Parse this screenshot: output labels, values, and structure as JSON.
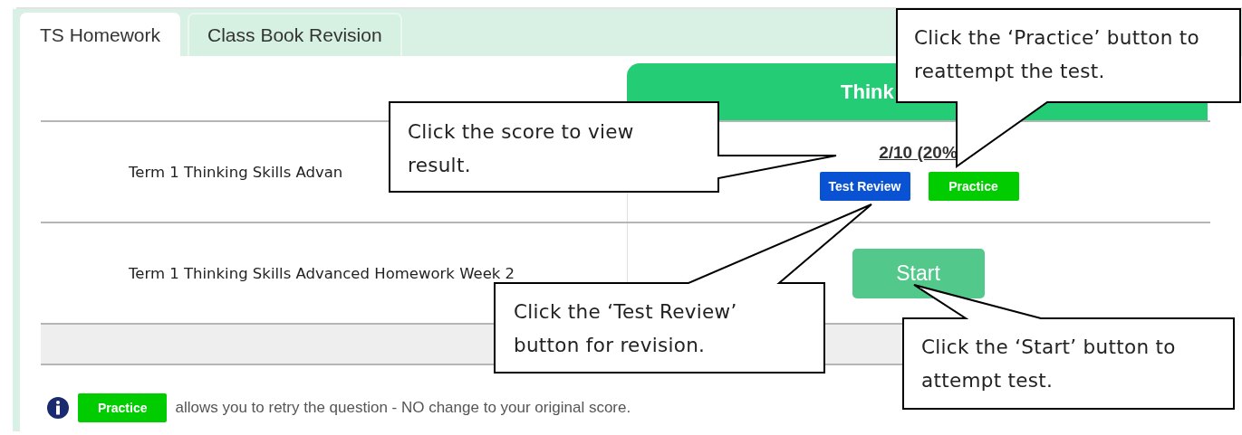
{
  "tabs": [
    {
      "label": "TS Homework",
      "selected": true
    },
    {
      "label": "Class Book Revision",
      "selected": false
    }
  ],
  "header": {
    "title": "Think"
  },
  "rows": [
    {
      "title": "Term 1 Thinking Skills Advan",
      "score": "2/10 (20%",
      "buttons": [
        {
          "label": "Test Review",
          "kind": "review"
        },
        {
          "label": "Practice",
          "kind": "practice"
        }
      ]
    },
    {
      "title": "Term 1 Thinking Skills Advanced Homework Week 2",
      "buttons": [
        {
          "label": "Start",
          "kind": "start"
        }
      ]
    }
  ],
  "footer": {
    "badge": "Practice",
    "note": "allows you to retry the question - NO change to your original score."
  },
  "callouts": [
    "Click the score to view result.",
    "Click the ‘Practice’ button to reattempt the test.",
    "Click the ‘Test Review’ button for revision.",
    "Click the ‘Start’ button to attempt test."
  ]
}
